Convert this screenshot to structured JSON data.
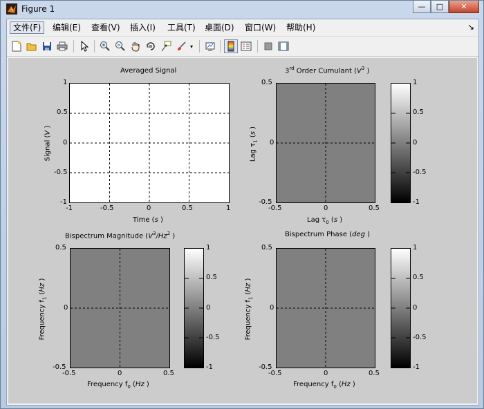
{
  "window": {
    "title": "Figure 1",
    "minimize": "—",
    "maximize": "□",
    "close": "✕"
  },
  "menu": {
    "items": [
      "文件(F)",
      "编辑(E)",
      "查看(V)",
      "插入(I)",
      "工具(T)",
      "桌面(D)",
      "窗口(W)",
      "帮助(H)"
    ],
    "overflow_arrow": "↘"
  },
  "toolbar": {
    "icons": [
      "new-figure-icon",
      "open-file-icon",
      "save-icon",
      "print-icon",
      "pointer-icon",
      "zoom-in-icon",
      "zoom-out-icon",
      "pan-hand-icon",
      "rotate-3d-icon",
      "data-cursor-icon",
      "brush-icon",
      "brush-dropdown-icon",
      "link-plot-icon",
      "colorbar-icon",
      "legend-icon",
      "hide-plot-tools-icon",
      "show-plot-tools-icon"
    ]
  },
  "colors": {
    "figure_bg": "#cccccc",
    "surface_gray": "#808080"
  },
  "plots": {
    "averaged": {
      "title": "Averaged Signal",
      "xlabel_main": "Time (",
      "xlabel_unit": "s",
      "xlabel_end": " )",
      "ylabel_main": "Signal (",
      "ylabel_unit": "V",
      "ylabel_end": " )",
      "xticks": [
        "-1",
        "-0.5",
        "0",
        "0.5",
        "1"
      ],
      "yticks": [
        "1",
        "0.5",
        "0",
        "-0.5",
        "-1"
      ]
    },
    "cumulant": {
      "title_pre": "3",
      "title_sup": "rd",
      "title_main": " Order Cumulant (",
      "title_unit": "V",
      "title_unit_sup": "3",
      "title_end": " )",
      "xlabel_main": "Lag τ",
      "xlabel_sub": "0",
      "xlabel_unit": "s",
      "ylabel_main": "Lag τ",
      "ylabel_sub": "1",
      "ylabel_unit": "s",
      "xticks": [
        "-0.5",
        "0",
        "0.5"
      ],
      "yticks": [
        "0.5",
        "0",
        "-0.5"
      ],
      "cbar_ticks": [
        "1",
        "0.5",
        "0",
        "-0.5",
        "-1"
      ]
    },
    "bispec_mag": {
      "title_main": "Bispectrum Magnitude (",
      "title_unit_a": "V",
      "title_unit_a_sup": "3",
      "title_unit_b": "/Hz",
      "title_unit_b_sup": "2",
      "title_end": " )",
      "xlabel_main": "Frequency f",
      "xlabel_sub": "0",
      "xlabel_unit": "Hz",
      "ylabel_main": "Frequency f",
      "ylabel_sub": "1",
      "ylabel_unit": "Hz",
      "xticks": [
        "-0.5",
        "0",
        "0.5"
      ],
      "yticks": [
        "0.5",
        "0",
        "-0.5"
      ],
      "cbar_ticks": [
        "1",
        "0.5",
        "0",
        "-0.5",
        "-1"
      ]
    },
    "bispec_phase": {
      "title_main": "Bispectrum Phase (",
      "title_unit": "deg",
      "title_end": " )",
      "xlabel_main": "Frequency f",
      "xlabel_sub": "0",
      "xlabel_unit": "Hz",
      "ylabel_main": "Frequency f",
      "ylabel_sub": "1",
      "ylabel_unit": "Hz",
      "xticks": [
        "-0.5",
        "0",
        "0.5"
      ],
      "yticks": [
        "0.5",
        "0",
        "-0.5"
      ],
      "cbar_ticks": [
        "1",
        "0.5",
        "0",
        "-0.5",
        "-1"
      ]
    }
  }
}
